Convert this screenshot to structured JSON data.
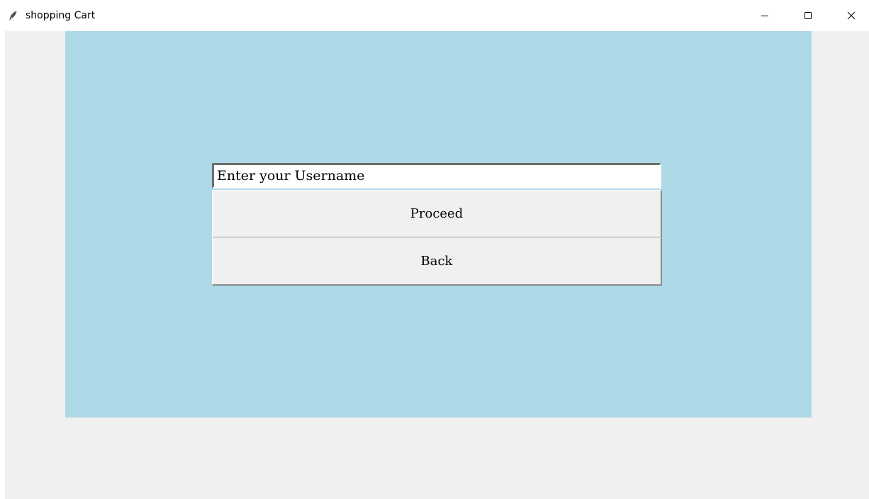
{
  "window": {
    "title": "shopping Cart",
    "icons": {
      "app": "feather-icon",
      "minimize": "minimize-icon",
      "maximize": "maximize-icon",
      "close": "close-icon"
    }
  },
  "form": {
    "username_value": "Enter your Username",
    "proceed_label": "Proceed",
    "back_label": "Back"
  },
  "colors": {
    "panel_background": "#add8e6",
    "client_background": "#f0f0f0",
    "button_face": "#f0f0f0"
  }
}
